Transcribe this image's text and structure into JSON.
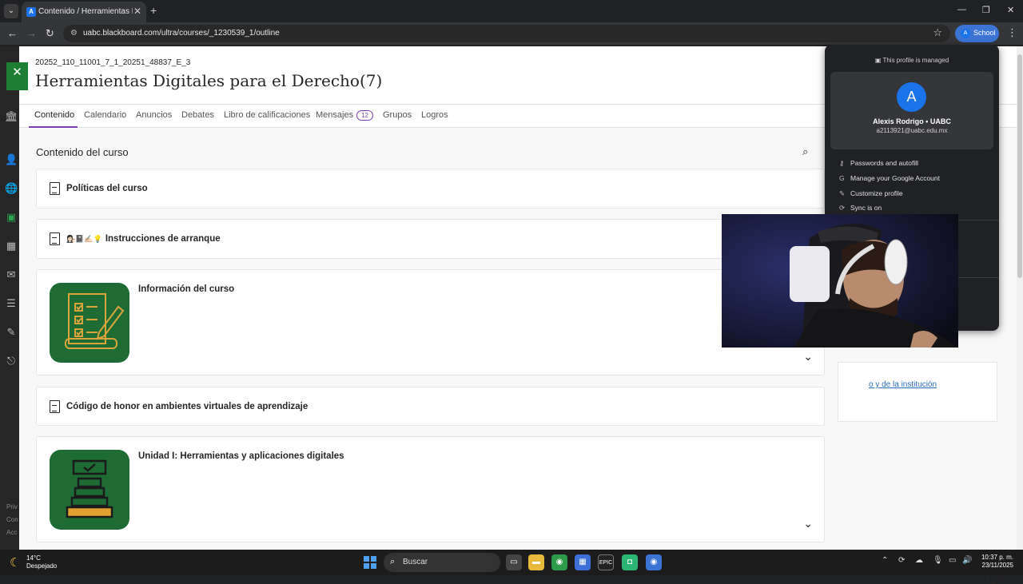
{
  "browser": {
    "tab_title": "Contenido / Herramientas Digit",
    "url": "uabc.blackboard.com/ultra/courses/_1230539_1/outline",
    "profile_label": "School",
    "profile_initial": "A"
  },
  "course": {
    "code": "20252_110_11001_7_1_20251_48837_E_3",
    "title": "Herramientas Digitales para el Derecho(7)",
    "tabs": [
      {
        "label": "Contenido"
      },
      {
        "label": "Calendario"
      },
      {
        "label": "Anuncios"
      },
      {
        "label": "Debates"
      },
      {
        "label": "Libro de calificaciones"
      },
      {
        "label": "Mensajes",
        "badge": "12"
      },
      {
        "label": "Grupos"
      },
      {
        "label": "Logros"
      }
    ],
    "section_title": "Contenido del curso",
    "items": [
      {
        "title": "Políticas del curso"
      },
      {
        "title": "Instrucciones de arranque",
        "emojis": "👩🏻‍⚖️📓✍🏻💡"
      },
      {
        "title": "Información del curso"
      },
      {
        "title": "Código de honor en ambientes virtuales de aprendizaje"
      },
      {
        "title": "Unidad I: Herramientas y aplicaciones digitales"
      }
    ],
    "side_link": "o y de la institución"
  },
  "leftnav_small": [
    "Priv",
    "Con",
    "Acc"
  ],
  "profile_menu": {
    "managed": "This profile is managed",
    "initial": "A",
    "name": "Alexis Rodrigo • UABC",
    "email": "a2113921@uabc.edu.mx",
    "items": [
      {
        "label": "Passwords and autofill"
      },
      {
        "label": "Manage your Google Account"
      },
      {
        "label": "Customize profile"
      },
      {
        "label": "Sync is on"
      }
    ]
  },
  "taskbar": {
    "temp": "14°C",
    "weather": "Despejado",
    "search": "Buscar",
    "time": "10:37 p. m.",
    "date": "23/11/2025"
  }
}
